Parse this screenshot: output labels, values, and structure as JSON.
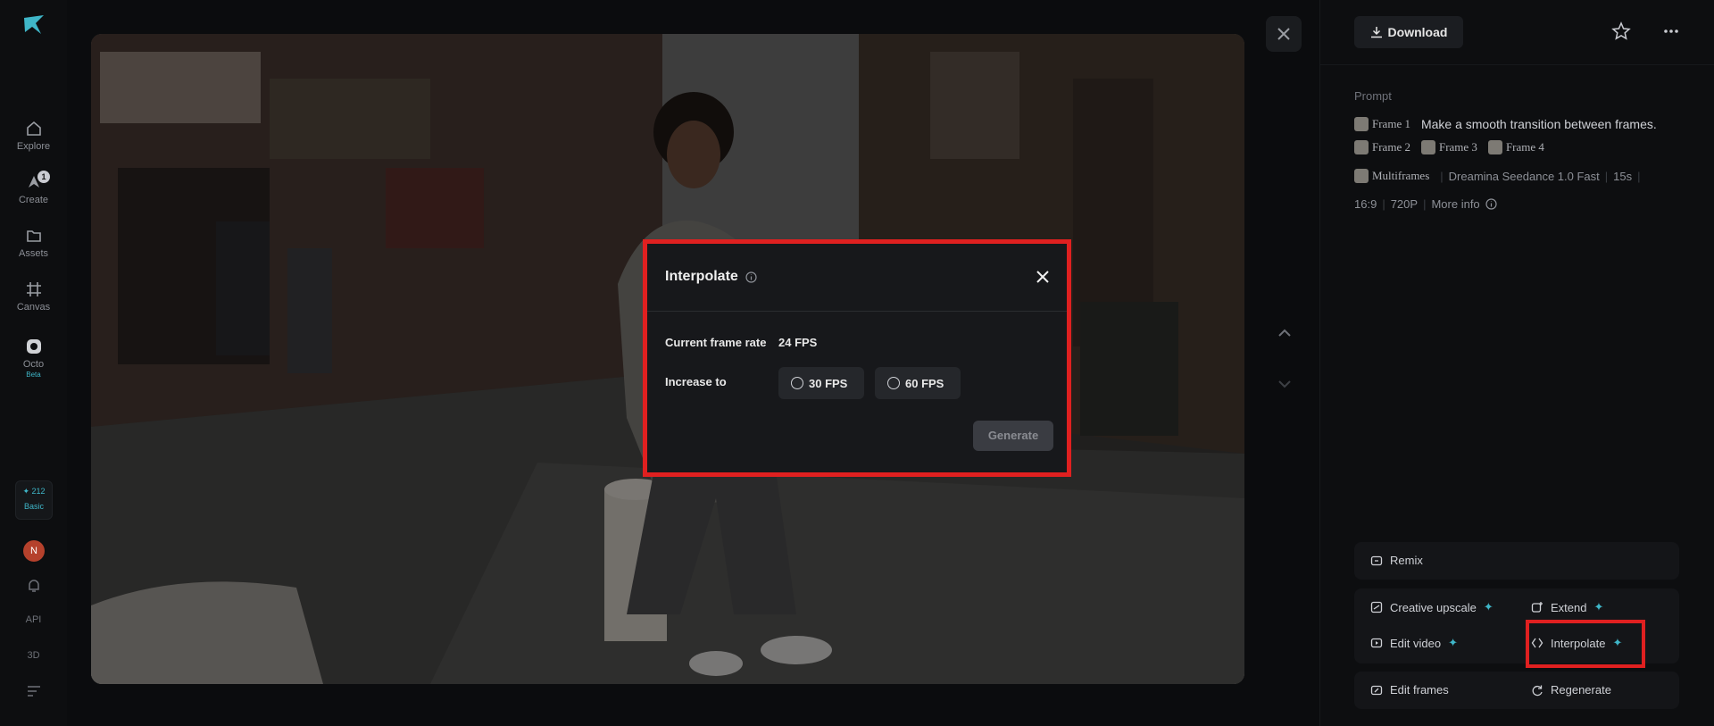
{
  "sidebar": {
    "items": [
      {
        "label": "Explore",
        "icon": "home-icon"
      },
      {
        "label": "Create",
        "icon": "create-icon",
        "badge": "1"
      },
      {
        "label": "Assets",
        "icon": "folder-icon"
      },
      {
        "label": "Canvas",
        "icon": "canvas-icon"
      },
      {
        "label": "Octo",
        "icon": "octo-icon",
        "tag": "Beta"
      }
    ],
    "credits": {
      "amount": "212",
      "tier": "Basic"
    },
    "avatar_initial": "N",
    "api_label": "API",
    "three_d_label": "3D"
  },
  "right_panel": {
    "download_label": "Download",
    "prompt_label": "Prompt",
    "frames": [
      "Frame 1",
      "Frame 2",
      "Frame 3",
      "Frame 4"
    ],
    "prompt_text": "Make a smooth transition between frames.",
    "mode": "Multiframes",
    "model": "Dreamina Seedance 1.0 Fast",
    "duration": "15s",
    "ratio": "16:9",
    "resolution": "720P",
    "more_info": "More info",
    "actions": {
      "remix": "Remix",
      "creative_upscale": "Creative upscale",
      "extend": "Extend",
      "edit_video": "Edit video",
      "interpolate": "Interpolate",
      "edit_frames": "Edit frames",
      "regenerate": "Regenerate"
    }
  },
  "modal": {
    "title": "Interpolate",
    "current_label": "Current frame rate",
    "current_value": "24 FPS",
    "increase_label": "Increase to",
    "options": [
      "30 FPS",
      "60 FPS"
    ],
    "generate_label": "Generate"
  },
  "colors": {
    "accent": "#3fb6c8",
    "highlight": "#e02020",
    "avatar": "#b5412c"
  }
}
